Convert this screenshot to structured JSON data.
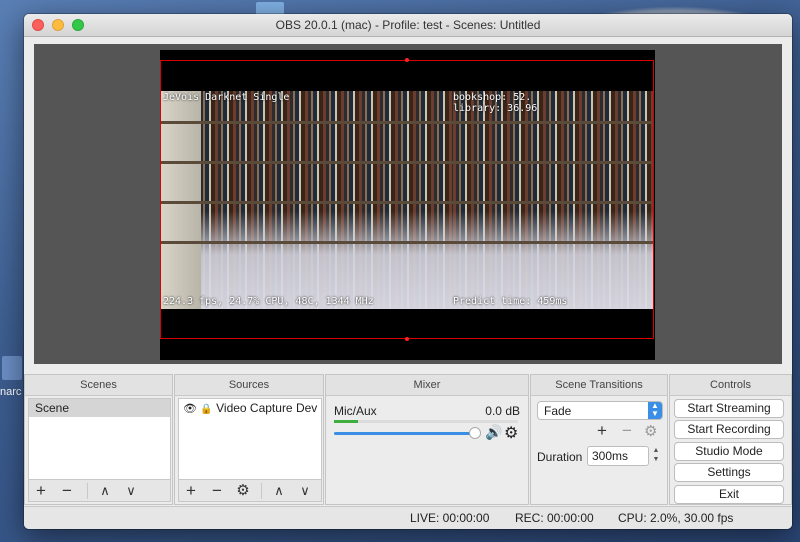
{
  "desktop": {
    "file_label": "narc"
  },
  "window": {
    "title": "OBS 20.0.1 (mac) - Profile: test - Scenes: Untitled"
  },
  "preview": {
    "left_top_text": "JeVois Darknet Single",
    "left_bottom_text": "224.3 fps, 24.7% CPU, 48C, 1344 MHz",
    "right_top_text_1": "bookshop: 52.",
    "right_top_text_2": "library: 36.96",
    "right_bottom_text": "Predict time: 459ms"
  },
  "scenes": {
    "header": "Scenes",
    "items": [
      "Scene"
    ]
  },
  "sources": {
    "header": "Sources",
    "items": [
      {
        "label": "Video Capture Dev"
      }
    ]
  },
  "mixer": {
    "header": "Mixer",
    "channel": "Mic/Aux",
    "level": "0.0 dB",
    "volume_fraction": 0.99
  },
  "transitions": {
    "header": "Scene Transitions",
    "selected": "Fade",
    "duration_label": "Duration",
    "duration_value": "300ms"
  },
  "controls": {
    "header": "Controls",
    "start_streaming": "Start Streaming",
    "start_recording": "Start Recording",
    "studio_mode": "Studio Mode",
    "settings": "Settings",
    "exit": "Exit"
  },
  "status": {
    "live": "LIVE: 00:00:00",
    "rec": "REC: 00:00:00",
    "cpu": "CPU: 2.0%, 30.00 fps"
  },
  "icons": {
    "plus": "+",
    "minus": "−",
    "up": "∧",
    "down": "∨",
    "gear": "⚙",
    "eye": "👁",
    "lock": "🔒",
    "speaker": "🔊"
  }
}
